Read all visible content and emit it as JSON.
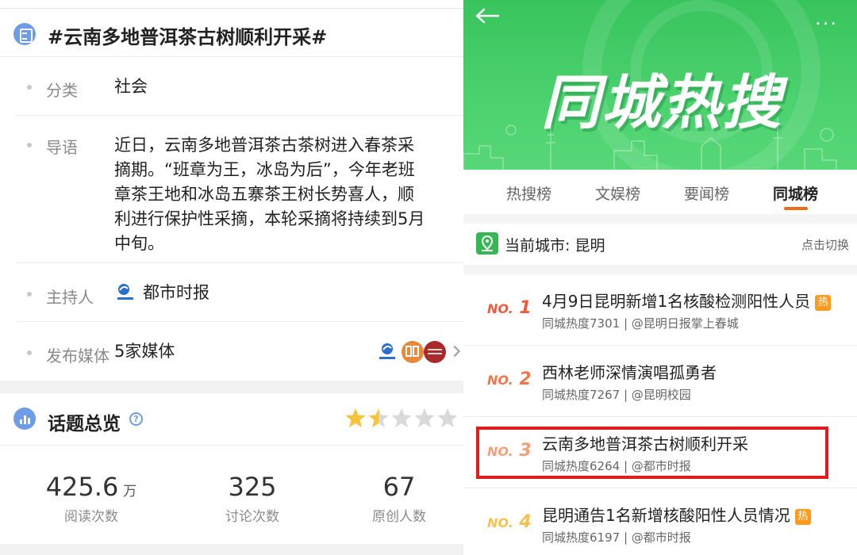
{
  "left": {
    "topic_title": "#云南多地普洱茶古树顺利开采#",
    "rows": {
      "category": {
        "label": "分类",
        "value": "社会"
      },
      "intro": {
        "label": "导语",
        "lines": [
          "近日，云南多地普洱茶古茶树进入春茶采",
          "摘期。“班章为王，冰岛为后”，今年老班",
          "章茶王地和冰岛五寨茶王树长势喜人，顺",
          "利进行保护性采摘，本轮采摘将持续到5月",
          "中旬。"
        ]
      },
      "host": {
        "label": "主持人",
        "value": "都市时报"
      },
      "media": {
        "label": "发布媒体",
        "value": "5家媒体"
      }
    },
    "overview": {
      "title": "话题总览",
      "help": "?",
      "rating": 1.5,
      "stats": [
        {
          "num": "425.6",
          "unit": "万",
          "caption": "阅读次数"
        },
        {
          "num": "325",
          "unit": "",
          "caption": "讨论次数"
        },
        {
          "num": "67",
          "unit": "",
          "caption": "原创人数"
        }
      ]
    }
  },
  "right": {
    "banner_title": "同城热搜",
    "more": "···",
    "tabs": [
      "热搜榜",
      "文娱榜",
      "要闻榜",
      "同城榜"
    ],
    "active_tab": "同城榜",
    "city_label": "当前城市: 昆明",
    "city_switch": "点击切换",
    "items": [
      {
        "rank": "NO.",
        "rank_num": "1",
        "title": "4月9日昆明新增1名核酸检测阳性人员",
        "hot": "热",
        "sub": "同城热度7301 | @昆明日报掌上春城",
        "color": "#f05a3c"
      },
      {
        "rank": "NO.",
        "rank_num": "2",
        "title": "西林老师深情演唱孤勇者",
        "hot": "",
        "sub": "同城热度7267 | @昆明校园",
        "color": "#f0754a"
      },
      {
        "rank": "NO.",
        "rank_num": "3",
        "title": "云南多地普洱茶古树顺利开采",
        "hot": "",
        "sub": "同城热度6264 | @都市时报",
        "color": "#f3a07a"
      },
      {
        "rank": "NO.",
        "rank_num": "4",
        "title": "昆明通告1名新增核酸阳性人员情况",
        "hot": "热",
        "sub": "同城热度6197 | @都市时报",
        "color": "#f6c24a"
      }
    ],
    "colors": {
      "green": "#3cc862",
      "accent": "#f06a1c",
      "highlight": "#e21c1c"
    }
  }
}
